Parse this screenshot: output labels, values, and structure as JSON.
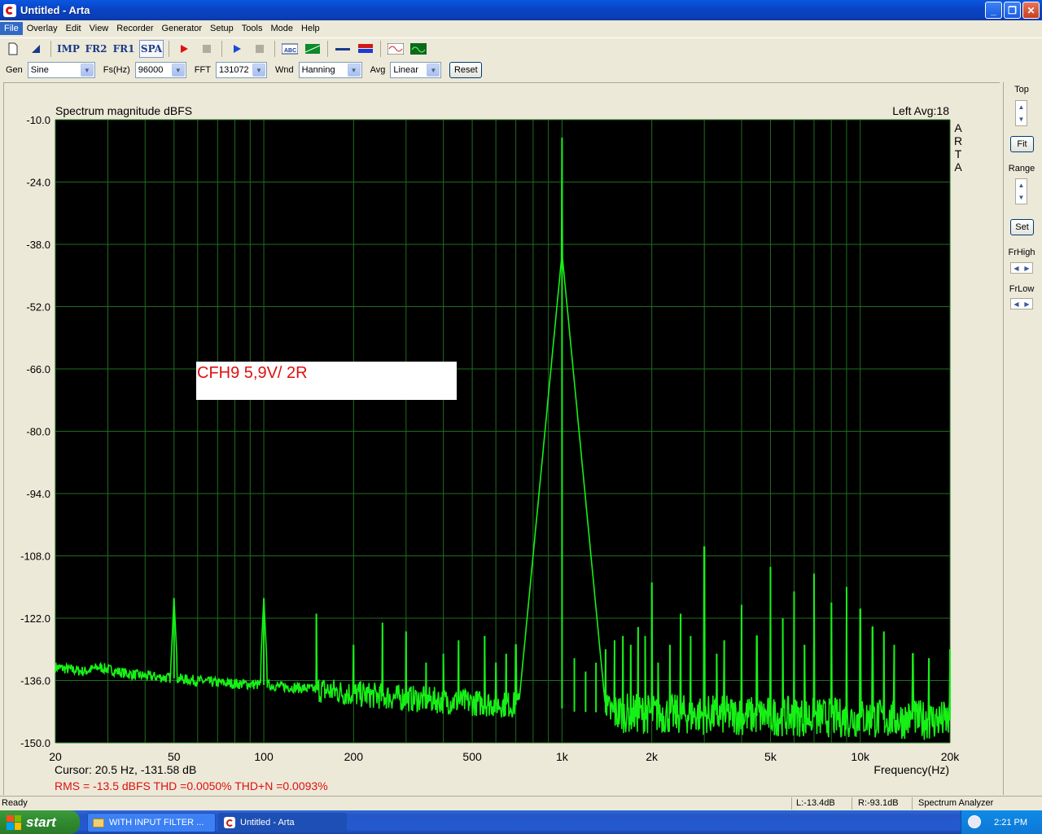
{
  "window": {
    "title": "Untitled - Arta"
  },
  "menu": [
    "File",
    "Overlay",
    "Edit",
    "View",
    "Recorder",
    "Generator",
    "Setup",
    "Tools",
    "Mode",
    "Help"
  ],
  "toolbar": {
    "imp": "IMP",
    "fr2": "FR2",
    "fr1": "FR1",
    "spa": "SPA"
  },
  "controls": {
    "gen_label": "Gen",
    "gen_value": "Sine",
    "fs_label": "Fs(Hz)",
    "fs_value": "96000",
    "fft_label": "FFT",
    "fft_value": "131072",
    "wnd_label": "Wnd",
    "wnd_value": "Hanning",
    "avg_label": "Avg",
    "avg_value": "Linear",
    "reset": "Reset"
  },
  "side": {
    "top": "Top",
    "fit": "Fit",
    "range": "Range",
    "set": "Set",
    "frhigh": "FrHigh",
    "frlow": "FrLow"
  },
  "chart_data": {
    "type": "line",
    "title": "Spectrum magnitude dBFS",
    "channel_info": "Left  Avg:18",
    "brand": "ARTA",
    "xlabel": "Frequency(Hz)",
    "ylim": [
      -150,
      -10
    ],
    "xlim": [
      20,
      20000
    ],
    "x_scale": "log",
    "y_ticks": [
      "-10.0",
      "-24.0",
      "-38.0",
      "-52.0",
      "-66.0",
      "-80.0",
      "-94.0",
      "-108.0",
      "-122.0",
      "-136.0",
      "-150.0"
    ],
    "x_ticks": [
      {
        "value": 20,
        "label": "20"
      },
      {
        "value": 50,
        "label": "50"
      },
      {
        "value": 100,
        "label": "100"
      },
      {
        "value": 200,
        "label": "200"
      },
      {
        "value": 500,
        "label": "500"
      },
      {
        "value": 1000,
        "label": "1k"
      },
      {
        "value": 2000,
        "label": "2k"
      },
      {
        "value": 5000,
        "label": "5k"
      },
      {
        "value": 10000,
        "label": "10k"
      },
      {
        "value": 20000,
        "label": "20k"
      }
    ],
    "annotation": "CFH9 5,9V/ 2R",
    "cursor": "Cursor:      20.5 Hz, -131.58 dB",
    "metrics": "RMS =  -13.5 dBFS   THD =0.0050%   THD+N =0.0093%",
    "noise_floor": [
      [
        20,
        -133
      ],
      [
        25,
        -134
      ],
      [
        28,
        -133
      ],
      [
        30,
        -133.5
      ],
      [
        35,
        -134.5
      ],
      [
        40,
        -135
      ],
      [
        50,
        -135.5
      ],
      [
        70,
        -136.5
      ],
      [
        100,
        -137
      ],
      [
        150,
        -138
      ],
      [
        200,
        -139
      ],
      [
        300,
        -140
      ],
      [
        500,
        -141
      ],
      [
        700,
        -141.5
      ],
      [
        900,
        -141.5
      ],
      [
        1100,
        -143
      ],
      [
        2000,
        -143.5
      ],
      [
        5000,
        -144
      ],
      [
        10000,
        -144.5
      ],
      [
        20000,
        -145
      ]
    ],
    "peaks": [
      {
        "f": 50,
        "db": -117.5
      },
      {
        "f": 100,
        "db": -117.5
      },
      {
        "f": 150,
        "db": -121
      },
      {
        "f": 200,
        "db": -128
      },
      {
        "f": 250,
        "db": -123
      },
      {
        "f": 300,
        "db": -125
      },
      {
        "f": 350,
        "db": -132
      },
      {
        "f": 400,
        "db": -130
      },
      {
        "f": 450,
        "db": -127
      },
      {
        "f": 550,
        "db": -126
      },
      {
        "f": 600,
        "db": -132
      },
      {
        "f": 650,
        "db": -130
      },
      {
        "f": 700,
        "db": -128
      },
      {
        "f": 1000,
        "db": -14
      },
      {
        "f": 1100,
        "db": -131
      },
      {
        "f": 1200,
        "db": -134
      },
      {
        "f": 1300,
        "db": -132
      },
      {
        "f": 1400,
        "db": -129
      },
      {
        "f": 1500,
        "db": -127
      },
      {
        "f": 1600,
        "db": -126
      },
      {
        "f": 1700,
        "db": -128
      },
      {
        "f": 1800,
        "db": -124
      },
      {
        "f": 1900,
        "db": -126
      },
      {
        "f": 2000,
        "db": -114
      },
      {
        "f": 2100,
        "db": -132
      },
      {
        "f": 2300,
        "db": -128
      },
      {
        "f": 2500,
        "db": -121
      },
      {
        "f": 2700,
        "db": -126
      },
      {
        "f": 3000,
        "db": -106
      },
      {
        "f": 3300,
        "db": -130
      },
      {
        "f": 3500,
        "db": -127
      },
      {
        "f": 4000,
        "db": -119
      },
      {
        "f": 4500,
        "db": -126
      },
      {
        "f": 5000,
        "db": -110.5
      },
      {
        "f": 5500,
        "db": -122
      },
      {
        "f": 6000,
        "db": -116
      },
      {
        "f": 6500,
        "db": -128
      },
      {
        "f": 7000,
        "db": -112
      },
      {
        "f": 8000,
        "db": -118.5
      },
      {
        "f": 9000,
        "db": -115
      },
      {
        "f": 10000,
        "db": -120
      },
      {
        "f": 11000,
        "db": -124
      },
      {
        "f": 12000,
        "db": -125
      },
      {
        "f": 13000,
        "db": -128
      },
      {
        "f": 15000,
        "db": -130
      },
      {
        "f": 17000,
        "db": -131
      },
      {
        "f": 20000,
        "db": -129
      }
    ],
    "line_color": "#17f017"
  },
  "statusbar": {
    "ready": "Ready",
    "left": "L:-13.4dB",
    "right": "R:-93.1dB",
    "mode": "Spectrum Analyzer"
  },
  "taskbar": {
    "start": "start",
    "task1": "WITH INPUT FILTER ...",
    "task2": "Untitled - Arta",
    "clock": "2:21 PM"
  },
  "colors": {
    "plot_bg": "#000000",
    "grid": "#1f6e1f",
    "trace": "#17f017",
    "metrics": "#e01010"
  }
}
